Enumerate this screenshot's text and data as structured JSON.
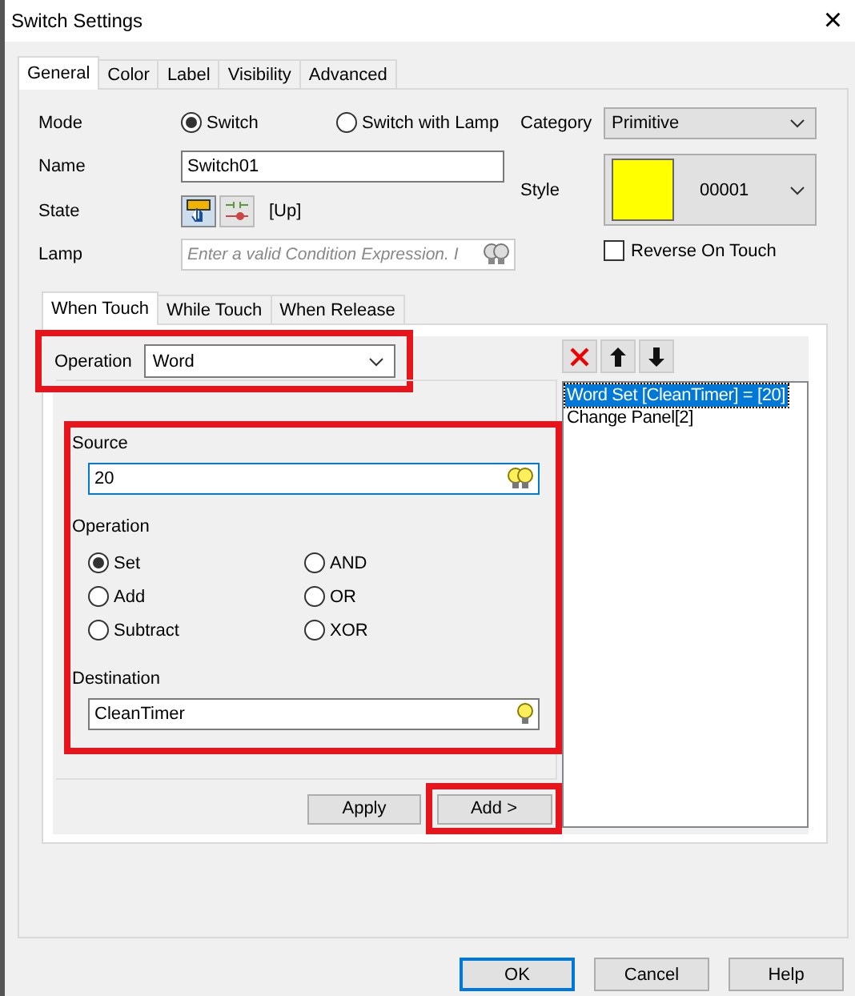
{
  "window": {
    "title": "Switch Settings",
    "close": "×"
  },
  "tabs": [
    {
      "label": "General",
      "selected": true
    },
    {
      "label": "Color",
      "selected": false
    },
    {
      "label": "Label",
      "selected": false
    },
    {
      "label": "Visibility",
      "selected": false
    },
    {
      "label": "Advanced",
      "selected": false
    }
  ],
  "mode": {
    "label": "Mode",
    "options": [
      {
        "label": "Switch",
        "selected": true
      },
      {
        "label": "Switch with Lamp",
        "selected": false
      }
    ]
  },
  "category": {
    "label": "Category",
    "value": "Primitive"
  },
  "name": {
    "label": "Name",
    "value": "Switch01"
  },
  "style": {
    "label": "Style",
    "value": "00001"
  },
  "state": {
    "label": "State",
    "value": "[Up]"
  },
  "lamp": {
    "label": "Lamp",
    "placeholder": "Enter a valid Condition Expression. I"
  },
  "reverse_on_touch": {
    "label": "Reverse On Touch",
    "checked": false
  },
  "action_tabs": [
    {
      "label": "When Touch",
      "selected": true
    },
    {
      "label": "While Touch",
      "selected": false
    },
    {
      "label": "When Release",
      "selected": false
    }
  ],
  "operation_type": {
    "label": "Operation",
    "value": "Word"
  },
  "source": {
    "label": "Source",
    "value": "20"
  },
  "operation": {
    "label": "Operation",
    "options": [
      {
        "label": "Set",
        "selected": true
      },
      {
        "label": "Add",
        "selected": false
      },
      {
        "label": "Subtract",
        "selected": false
      },
      {
        "label": "AND",
        "selected": false
      },
      {
        "label": "OR",
        "selected": false
      },
      {
        "label": "XOR",
        "selected": false
      }
    ]
  },
  "destination": {
    "label": "Destination",
    "value": "CleanTimer"
  },
  "actions": [
    {
      "text": "Word Set [CleanTimer] = [20]",
      "selected": true
    },
    {
      "text": "Change Panel[2]",
      "selected": false
    }
  ],
  "action_buttons": [
    "Apply",
    "Add >"
  ],
  "buttons": [
    {
      "label": "OK",
      "default": true
    },
    {
      "label": "Cancel",
      "default": false
    },
    {
      "label": "Help",
      "default": false
    }
  ]
}
